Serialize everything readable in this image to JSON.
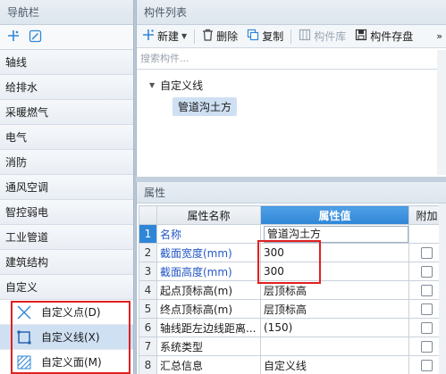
{
  "nav": {
    "title": "导航栏",
    "items": [
      "轴线",
      "给排水",
      "采暖燃气",
      "电气",
      "消防",
      "通风空调",
      "智控弱电",
      "工业管道",
      "建筑结构",
      "自定义"
    ],
    "sub_items": [
      {
        "label": "自定义点(D)",
        "icon": "point-cross-icon"
      },
      {
        "label": "自定义线(X)",
        "icon": "line-rect-icon"
      },
      {
        "label": "自定义面(M)",
        "icon": "hatch-area-icon"
      }
    ]
  },
  "component_list": {
    "title": "构件列表",
    "toolbar": {
      "new": "新建",
      "delete": "删除",
      "copy": "复制",
      "library": "构件库",
      "save": "构件存盘",
      "more": "»"
    },
    "search_placeholder": "搜索构件...",
    "tree": {
      "root": "自定义线",
      "child": "管道沟土方"
    }
  },
  "properties": {
    "title": "属性",
    "headers": {
      "name": "属性名称",
      "value": "属性值",
      "add": "附加"
    },
    "rows": [
      {
        "num": "1",
        "name": "名称",
        "value": "管道沟土方",
        "checkbox": false
      },
      {
        "num": "2",
        "name": "截面宽度(mm)",
        "value": "300",
        "checkbox": true
      },
      {
        "num": "3",
        "name": "截面高度(mm)",
        "value": "300",
        "checkbox": true
      },
      {
        "num": "4",
        "name": "起点顶标高(m)",
        "value": "层顶标高",
        "checkbox": true
      },
      {
        "num": "5",
        "name": "终点顶标高(m)",
        "value": "层顶标高",
        "checkbox": true
      },
      {
        "num": "6",
        "name": "轴线距左边线距离...",
        "value": "(150)",
        "checkbox": true
      },
      {
        "num": "7",
        "name": "系统类型",
        "value": "",
        "checkbox": true
      },
      {
        "num": "8",
        "name": "汇总信息",
        "value": "自定义线",
        "checkbox": true
      }
    ]
  },
  "colors": {
    "accent": "#2f86d6",
    "highlight_box": "#e02020",
    "blue_text": "#2457c5"
  }
}
